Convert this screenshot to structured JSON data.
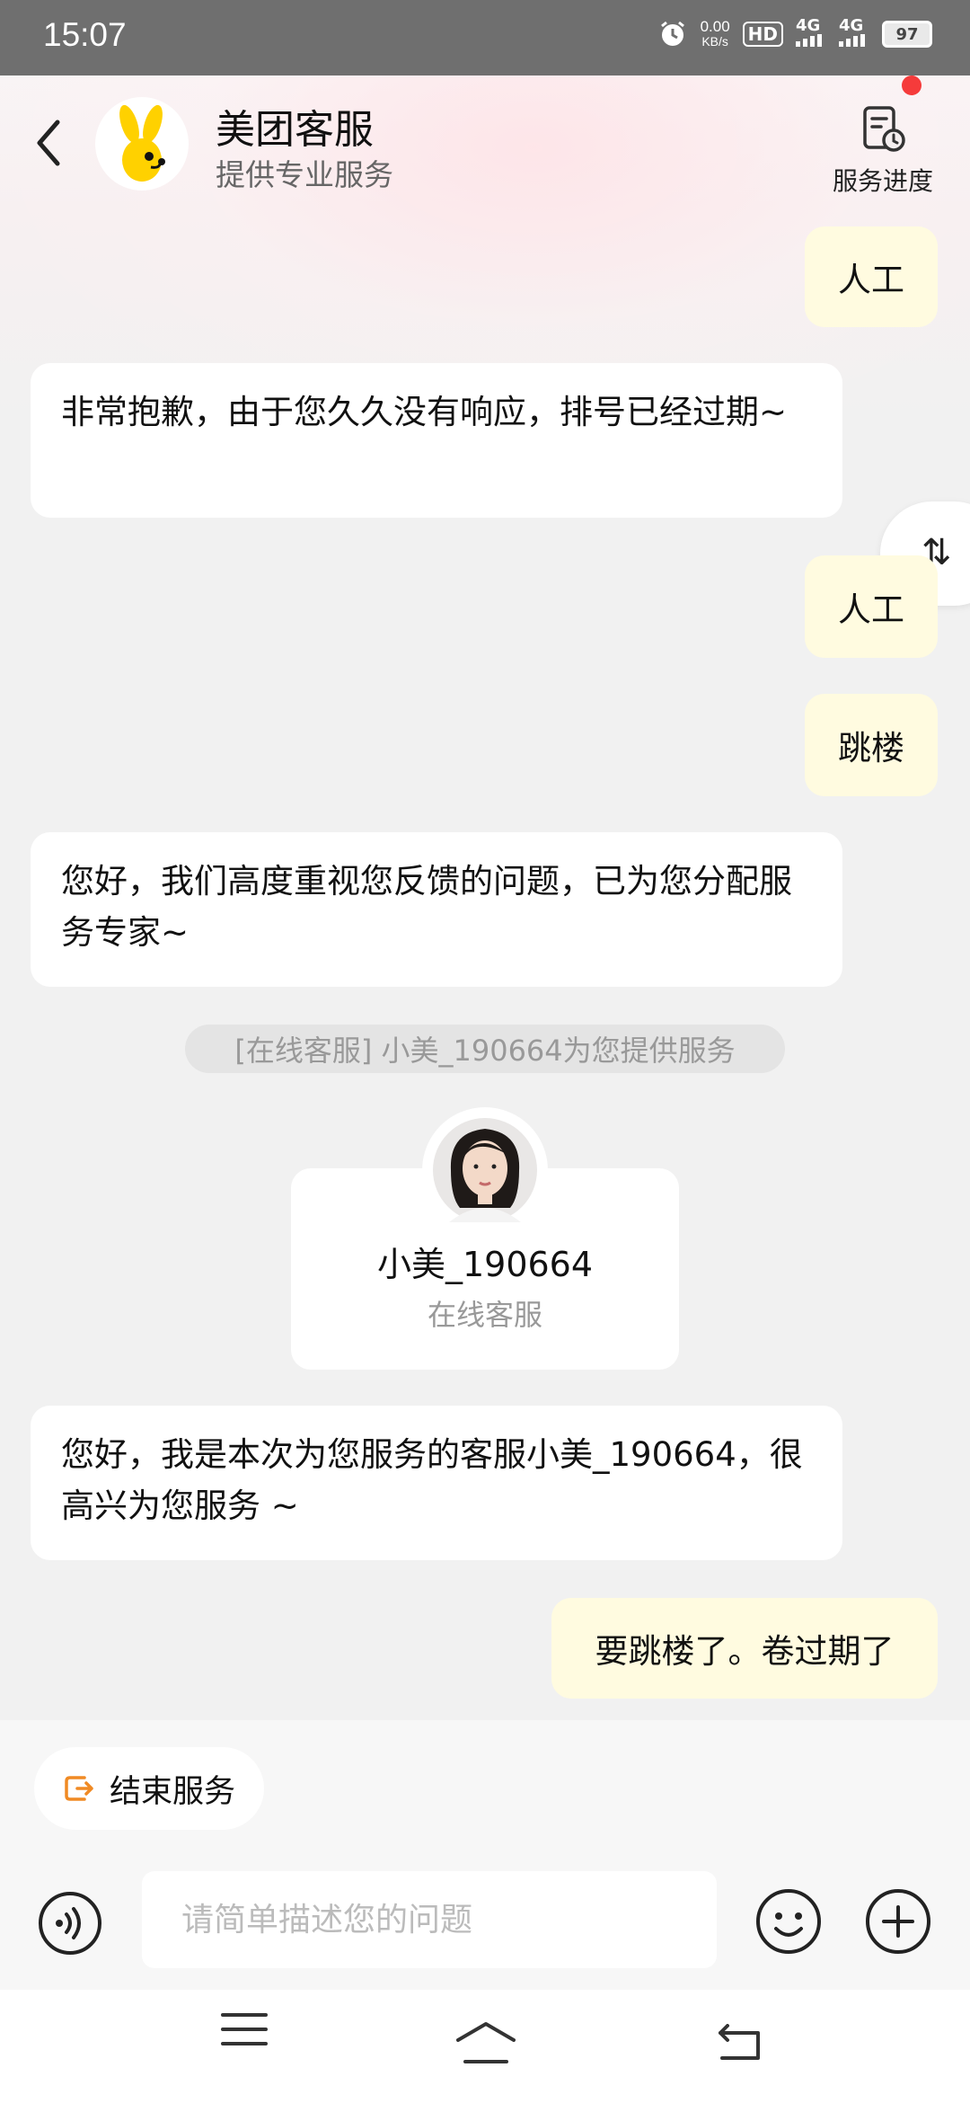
{
  "status_bar": {
    "time": "15:07",
    "net_speed_value": "0.00",
    "net_speed_unit": "KB/s",
    "hd_label": "HD",
    "sim1_label": "4G",
    "sim2_label": "4G",
    "battery": "97"
  },
  "header": {
    "title": "美团客服",
    "subtitle": "提供专业服务",
    "progress_label": "服务进度"
  },
  "messages": {
    "m1": "人工",
    "m2": "非常抱歉，由于您久久没有响应，排号已经过期~",
    "m3": "人工",
    "m4": "跳楼",
    "m5": "您好，我们高度重视您反馈的问题，已为您分配服务专家~",
    "system_notice": "[在线客服] 小美_190664为您提供服务",
    "m6": "您好，我是本次为您服务的客服小美_190664，很高兴为您服务 ~",
    "m7": "要跳楼了。卷过期了"
  },
  "agent_card": {
    "name": "小美_190664",
    "role": "在线客服"
  },
  "bottom": {
    "end_service_label": "结束服务",
    "input_placeholder": "请简单描述您的问题"
  },
  "colors": {
    "user_bubble": "#fffbe0",
    "agent_bubble": "#ffffff",
    "end_icon": "#f08a24",
    "red_dot": "#f53b3b"
  }
}
